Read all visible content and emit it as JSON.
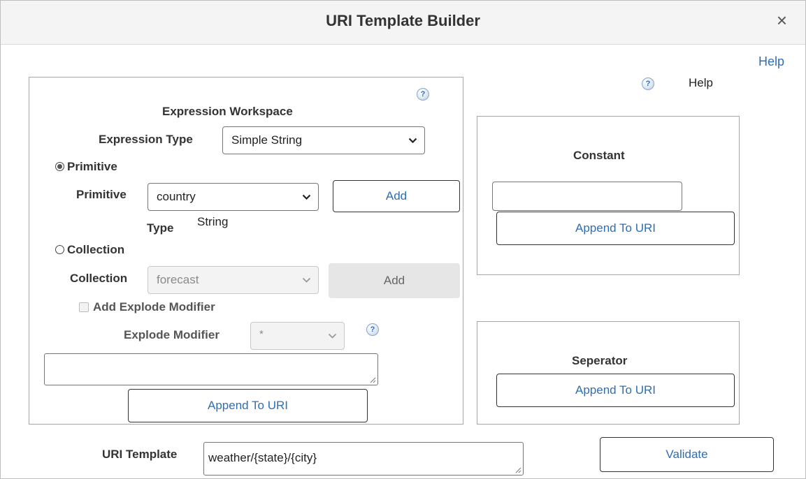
{
  "dialog": {
    "title": "URI Template Builder",
    "close_glyph": "×",
    "help_link": "Help"
  },
  "right_help": {
    "icon_glyph": "?",
    "label": "Help"
  },
  "expression_workspace": {
    "heading": "Expression Workspace",
    "help_icon_glyph": "?",
    "expression_type_label": "Expression Type",
    "expression_type_value": "Simple String",
    "primitive_radio_label": "Primitive",
    "primitive_label": "Primitive",
    "primitive_value": "country",
    "primitive_add_label": "Add",
    "type_label": "Type",
    "type_value": "String",
    "collection_radio_label": "Collection",
    "collection_label": "Collection",
    "collection_value": "forecast",
    "collection_add_label": "Add",
    "explode_checkbox_label": "Add Explode Modifier",
    "explode_modifier_label": "Explode Modifier",
    "explode_modifier_value": "*",
    "explode_help_glyph": "?",
    "expression_text_value": "",
    "append_label": "Append To URI"
  },
  "constant": {
    "heading": "Constant",
    "value": "",
    "append_label": "Append To URI"
  },
  "separator": {
    "heading": "Seperator",
    "append_label": "Append To URI"
  },
  "uri_template": {
    "label": "URI Template",
    "value": "weather/{state}/{city}",
    "validate_label": "Validate"
  },
  "colors": {
    "link": "#2f6db5",
    "border": "#a6a6a6",
    "titlebar": "#f4f4f4"
  }
}
